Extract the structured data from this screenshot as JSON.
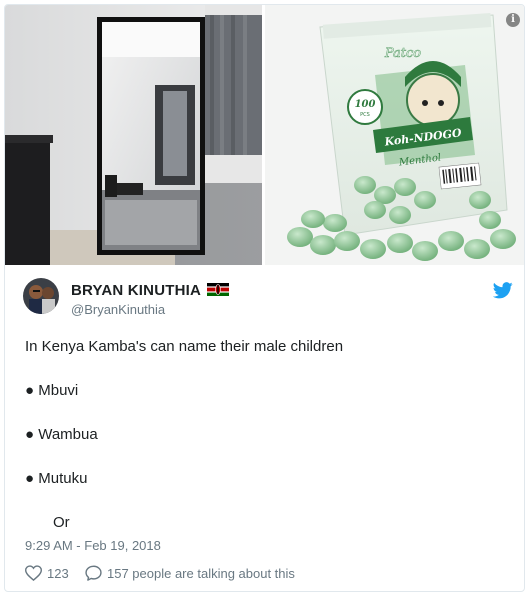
{
  "media": {
    "left_image": "mirror-photo",
    "right_image": "mint-candy-bag-photo",
    "info_icon": "info-icon",
    "bag_brand": "Patco",
    "bag_count": "100",
    "bag_count_unit": "PCS",
    "bag_label": "Koh-NDOGO",
    "bag_sublabel": "Menthol"
  },
  "author": {
    "name": "BRYAN KINUTHIA",
    "handle": "@BryanKinuthia",
    "flag_icon": "kenya-flag-icon",
    "platform_icon": "twitter-bird-icon",
    "brand_color": "#1da1f2"
  },
  "tweet": {
    "line1": "In Kenya Kamba's can name their male children",
    "items": [
      "● Mbuvi",
      "● Wambua",
      "● Mutuku"
    ],
    "tail": "Or"
  },
  "meta": {
    "timestamp": "9:29 AM - Feb 19, 2018",
    "likes": "123",
    "replies_text": "157 people are talking about this"
  }
}
